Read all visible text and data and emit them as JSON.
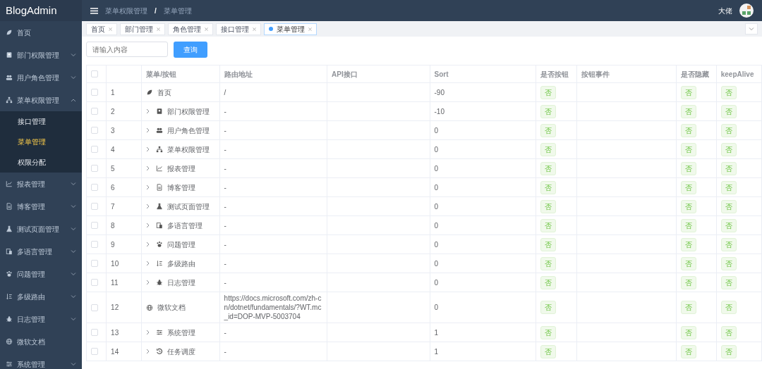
{
  "brand": "BlogAdmin",
  "sidebar": {
    "items": [
      {
        "label": "首页"
      },
      {
        "label": "部门权限管理",
        "expanded": false
      },
      {
        "label": "用户角色管理",
        "expanded": false
      },
      {
        "label": "菜单权限管理",
        "expanded": true,
        "children": [
          {
            "label": "接口管理",
            "selected": false
          },
          {
            "label": "菜单管理",
            "selected": true
          },
          {
            "label": "权限分配",
            "selected": false
          }
        ]
      },
      {
        "label": "报表管理",
        "expanded": false
      },
      {
        "label": "博客管理",
        "expanded": false
      },
      {
        "label": "测试页面管理",
        "expanded": false
      },
      {
        "label": "多语言管理",
        "expanded": false
      },
      {
        "label": "问题管理",
        "expanded": false
      },
      {
        "label": "多级路由",
        "expanded": false
      },
      {
        "label": "日志管理",
        "expanded": false
      },
      {
        "label": "微软文档"
      },
      {
        "label": "系统管理",
        "expanded": false
      }
    ]
  },
  "breadcrumb": [
    "菜单权限管理",
    "菜单管理"
  ],
  "breadcrumb_separator": "/",
  "user": {
    "name": "大佬"
  },
  "tags": [
    {
      "label": "首页",
      "selected": false
    },
    {
      "label": "部门管理",
      "selected": false
    },
    {
      "label": "角色管理",
      "selected": false
    },
    {
      "label": "接口管理",
      "selected": false
    },
    {
      "label": "菜单管理",
      "selected": true
    }
  ],
  "search": {
    "placeholder": "请输入内容",
    "button": "查询"
  },
  "table": {
    "select_all": {
      "checked": false
    },
    "columns": [
      "菜单/按钮",
      "路由地址",
      "API接口",
      "Sort",
      "是否按钮",
      "按钮事件",
      "是否隐藏",
      "keepAlive"
    ],
    "rows": [
      {
        "checked": false,
        "index": "1",
        "expandable": false,
        "name": "首页",
        "route": "/",
        "sort": "-90",
        "is_button": "否",
        "hidden": "否",
        "keep_alive": "否"
      },
      {
        "checked": false,
        "index": "2",
        "expandable": true,
        "name": "部门权限管理",
        "route": "-",
        "sort": "-10",
        "is_button": "否",
        "hidden": "否",
        "keep_alive": "否"
      },
      {
        "checked": false,
        "index": "3",
        "expandable": true,
        "name": "用户角色管理",
        "route": "-",
        "sort": "0",
        "is_button": "否",
        "hidden": "否",
        "keep_alive": "否"
      },
      {
        "checked": false,
        "index": "4",
        "expandable": true,
        "name": "菜单权限管理",
        "route": "-",
        "sort": "0",
        "is_button": "否",
        "hidden": "否",
        "keep_alive": "否"
      },
      {
        "checked": false,
        "index": "5",
        "expandable": true,
        "name": "报表管理",
        "route": "-",
        "sort": "0",
        "is_button": "否",
        "hidden": "否",
        "keep_alive": "否"
      },
      {
        "checked": false,
        "index": "6",
        "expandable": true,
        "name": "博客管理",
        "route": "-",
        "sort": "0",
        "is_button": "否",
        "hidden": "否",
        "keep_alive": "否"
      },
      {
        "checked": false,
        "index": "7",
        "expandable": true,
        "name": "测试页面管理",
        "route": "-",
        "sort": "0",
        "is_button": "否",
        "hidden": "否",
        "keep_alive": "否"
      },
      {
        "checked": false,
        "index": "8",
        "expandable": true,
        "name": "多语言管理",
        "route": "-",
        "sort": "0",
        "is_button": "否",
        "hidden": "否",
        "keep_alive": "否"
      },
      {
        "checked": false,
        "index": "9",
        "expandable": true,
        "name": "问题管理",
        "route": "-",
        "sort": "0",
        "is_button": "否",
        "hidden": "否",
        "keep_alive": "否"
      },
      {
        "checked": false,
        "index": "10",
        "expandable": true,
        "name": "多级路由",
        "route": "-",
        "sort": "0",
        "is_button": "否",
        "hidden": "否",
        "keep_alive": "否"
      },
      {
        "checked": false,
        "index": "11",
        "expandable": true,
        "name": "日志管理",
        "route": "-",
        "sort": "0",
        "is_button": "否",
        "hidden": "否",
        "keep_alive": "否"
      },
      {
        "checked": false,
        "index": "12",
        "expandable": false,
        "name": "微软文档",
        "route": "https://docs.microsoft.com/zh-cn/dotnet/fundamentals/?WT.mc_id=DOP-MVP-5003704",
        "sort": "0",
        "is_button": "否",
        "hidden": "否",
        "keep_alive": "否"
      },
      {
        "checked": false,
        "index": "13",
        "expandable": true,
        "name": "系统管理",
        "route": "-",
        "sort": "1",
        "is_button": "否",
        "hidden": "否",
        "keep_alive": "否"
      },
      {
        "checked": false,
        "index": "14",
        "expandable": true,
        "name": "任务调度",
        "route": "-",
        "sort": "1",
        "is_button": "否",
        "hidden": "否",
        "keep_alive": "否"
      }
    ]
  }
}
